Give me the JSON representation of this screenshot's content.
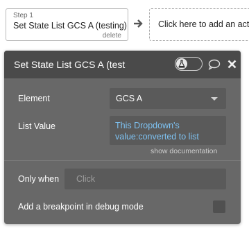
{
  "step": {
    "number": "Step 1",
    "title": "Set State List GCS A (testing)",
    "delete_label": "delete"
  },
  "add_action": {
    "label": "Click here to add an acti"
  },
  "panel": {
    "title": "Set State List GCS A (test",
    "element_label": "Element",
    "element_value": "GCS A",
    "list_value_label": "List Value",
    "list_value_expression": "This Dropdown's value:converted to list",
    "show_documentation": "show documentation",
    "only_when_label": "Only when",
    "only_when_placeholder": "Click",
    "breakpoint_label": "Add a breakpoint in debug mode"
  },
  "icons": [
    "arrow-right-icon",
    "flask-icon",
    "comment-icon",
    "close-icon",
    "chevron-down-icon"
  ],
  "colors": {
    "panel_bg": "#686868",
    "header_bg": "#4a4a4a",
    "input_bg": "#5a5a5a",
    "expression_text": "#7ec2f2"
  }
}
